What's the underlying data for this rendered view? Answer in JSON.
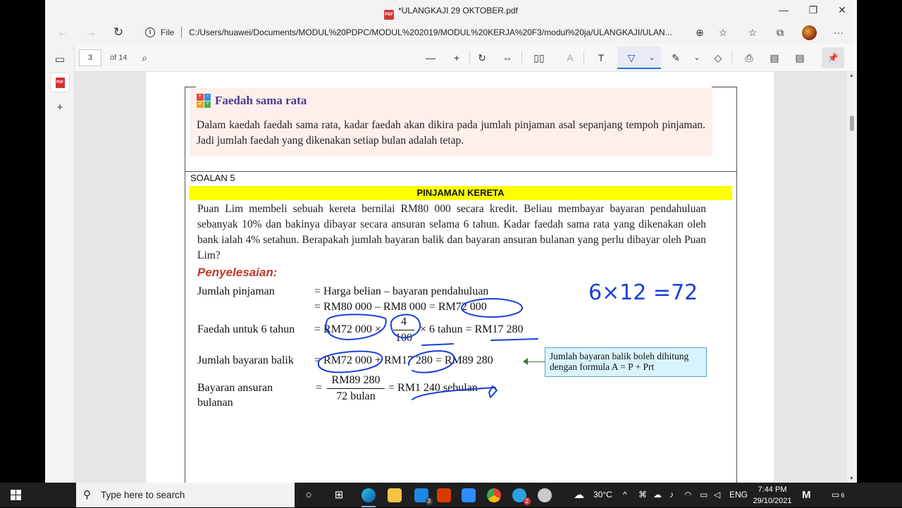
{
  "window": {
    "title": "*ULANGKAJI 29 OKTOBER.pdf",
    "pdf_badge": "PDF",
    "minimize": "—",
    "maximize": "❐",
    "close": "✕"
  },
  "addressbar": {
    "back": "←",
    "forward": "→",
    "refresh": "↻",
    "info": "i",
    "file_label": "File",
    "url": "C:/Users/huawei/Documents/MODUL%20PDPC/MODUL%202019/MODUL%20KERJA%20F3/modul%20ja/ULANGKAJI/ULAN...",
    "zoom_icon": "⊕",
    "fav_add": "☆",
    "favorites": "☆",
    "collections": "⧉",
    "more": "···"
  },
  "tabs": {
    "tab_actions": "▭",
    "pdf_tab": "PDF",
    "new_tab": "+"
  },
  "pdf_toolbar": {
    "page_number": "3",
    "page_count": "of 14",
    "search": "⌕",
    "zoom_out": "—",
    "zoom_in": "+",
    "rotate": "↻",
    "fit": "⇔",
    "page_view": "▯▯",
    "read_aloud": "A",
    "text": "T",
    "draw": "▽",
    "draw_dropdown": "⌄",
    "highlight": "✎",
    "highlight_dropdown": "⌄",
    "erase": "◇",
    "print": "⎙",
    "save": "▤",
    "save_as": "▤",
    "pin": "📌"
  },
  "document": {
    "info_title": "Faedah sama rata",
    "info_icon": [
      "+",
      "−",
      "×",
      "÷"
    ],
    "info_body": "Dalam kaedah faedah sama rata, kadar faedah akan dikira pada jumlah pinjaman asal sepanjang tempoh pinjaman. Jadi jumlah faedah yang dikenakan setiap bulan adalah tetap.",
    "soalan": "SOALAN 5",
    "header": "PINJAMAN KERETA",
    "question": "Puan Lim membeli sebuah kereta bernilai RM80 000 secara kredit. Beliau membayar bayaran pendahuluan sebanyak 10% dan bakinya dibayar secara ansuran selama 6 tahun. Kadar faedah sama rata yang dikenakan oleh bank ialah 4% setahun. Berapakah jumlah bayaran balik dan bayaran ansuran bulanan yang perlu dibayar oleh Puan Lim?",
    "penyelesaian": "Penyelesaian:",
    "rows": {
      "r1_label": "Jumlah pinjaman",
      "r1_line1": "= Harga belian – bayaran pendahuluan",
      "r1_line2": "= RM80 000 – RM8 000 = RM72 000",
      "r2_label": "Faedah untuk 6 tahun",
      "r2_left": "= RM72 000 ×",
      "r2_num": "4",
      "r2_den": "100",
      "r2_right": "× 6 tahun = RM17 280",
      "r3_label": "Jumlah bayaran balik",
      "r3_expr": "= RM72 000 + RM17 280 = RM89 280",
      "r4_label_1": "Bayaran ansuran",
      "r4_label_2": "bulanan",
      "r4_eq": "=",
      "r4_num": "RM89 280",
      "r4_den": "72 bulan",
      "r4_result": "= RM1 240 sebulan"
    },
    "callout_line1": "Jumlah bayaran balik boleh dihitung",
    "callout_line2": "dengan formula A = P + Prt",
    "handwriting": "6×12 =72"
  },
  "taskbar": {
    "search_placeholder": "Type here to search",
    "search_icon": "⚲",
    "task_view": "○",
    "widgets": "⊞",
    "mail_badge": "3",
    "telegram_badge": "2",
    "weather": "30°C",
    "tray_up": "^",
    "language": "ENG",
    "time": "7:44 PM",
    "date": "29/10/2021",
    "notifications": "6"
  },
  "colors": {
    "info_panel_bg": "#fdf0ec",
    "info_title": "#4a3a8a",
    "header_bar": "#ffff00",
    "solution_label": "#c0392b",
    "ink": "#1a3fd6",
    "callout_bg": "#d8f3fb",
    "callout_arrow": "#2e7d32"
  }
}
